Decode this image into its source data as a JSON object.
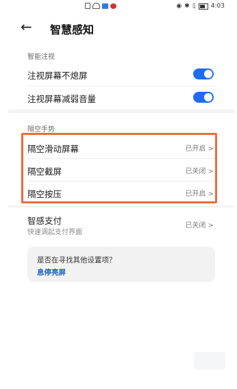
{
  "status_bar": {
    "time": "4:03"
  },
  "header": {
    "title": "智慧感知"
  },
  "sections": {
    "smart_gaze": {
      "title": "智能注视",
      "items": [
        {
          "label": "注视屏幕不熄屏",
          "toggle_on": true
        },
        {
          "label": "注视屏幕减弱音量",
          "toggle_on": true
        }
      ]
    },
    "air_gesture": {
      "title": "隔空手势",
      "items": [
        {
          "label": "隔空滑动屏幕",
          "status": "已开启 >"
        },
        {
          "label": "隔空截屏",
          "status": "已关闭 >"
        },
        {
          "label": "隔空按压",
          "status": "已开启 >"
        }
      ]
    },
    "smart_pay": {
      "label": "智感支付",
      "subtitle": "快速调起支付界面",
      "status": "已关闭 >"
    }
  },
  "suggestion_card": {
    "question": "是否在寻找其他设置项？",
    "link": "息停亮屏"
  },
  "colors": {
    "toggle_on": "#1e6cf2",
    "highlight_border": "#ec6c3b",
    "link": "#1c5fc4"
  }
}
